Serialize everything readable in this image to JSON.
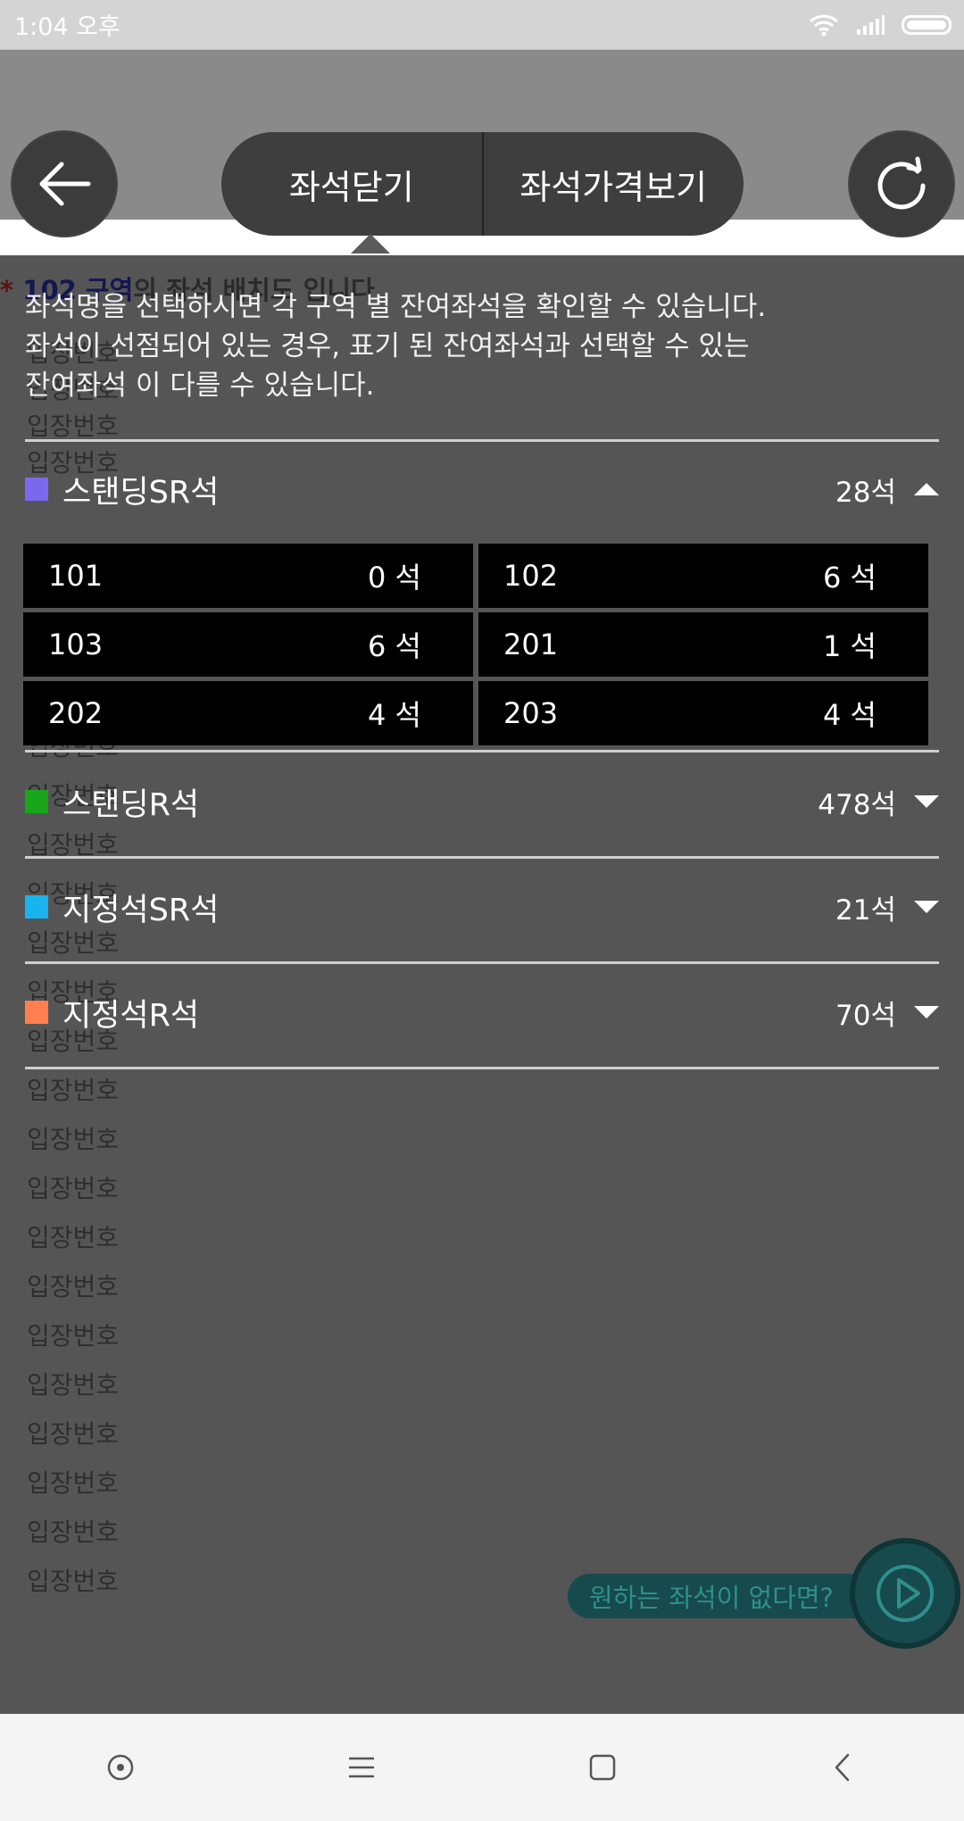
{
  "status_bar": {
    "time": "1:04 오후"
  },
  "toolbar": {
    "close_seats_label": "좌석닫기",
    "view_prices_label": "좌석가격보기"
  },
  "background": {
    "notice_star": "*",
    "notice_highlight": "102 구역",
    "notice_rest": "의 좌석 배치도 입니다",
    "entry_label": "입장번호"
  },
  "info_text": [
    "좌석명을 선택하시면 각 구역 별 잔여좌석을 확인할 수 있습니다.",
    "좌석이 선점되어 있는 경우, 표기 된 잔여좌석과 선택할 수 있는",
    "잔여좌석 이 다를 수 있습니다."
  ],
  "categories": [
    {
      "label": "스탠딩SR석",
      "count": "28석",
      "color": "#7b68ee",
      "expanded": true
    },
    {
      "label": "스탠딩R석",
      "count": "478석",
      "color": "#1aa61a",
      "expanded": false
    },
    {
      "label": "지정석SR석",
      "count": "21석",
      "color": "#19b4f0",
      "expanded": false
    },
    {
      "label": "지정석R석",
      "count": "70석",
      "color": "#ff7f50",
      "expanded": false
    }
  ],
  "sections": [
    {
      "name": "101",
      "seats": "0 석"
    },
    {
      "name": "102",
      "seats": "6 석"
    },
    {
      "name": "103",
      "seats": "6 석"
    },
    {
      "name": "201",
      "seats": "1 석"
    },
    {
      "name": "202",
      "seats": "4 석"
    },
    {
      "name": "203",
      "seats": "4 석"
    }
  ],
  "floating": {
    "label": "원하는 좌석이 없다면?"
  }
}
